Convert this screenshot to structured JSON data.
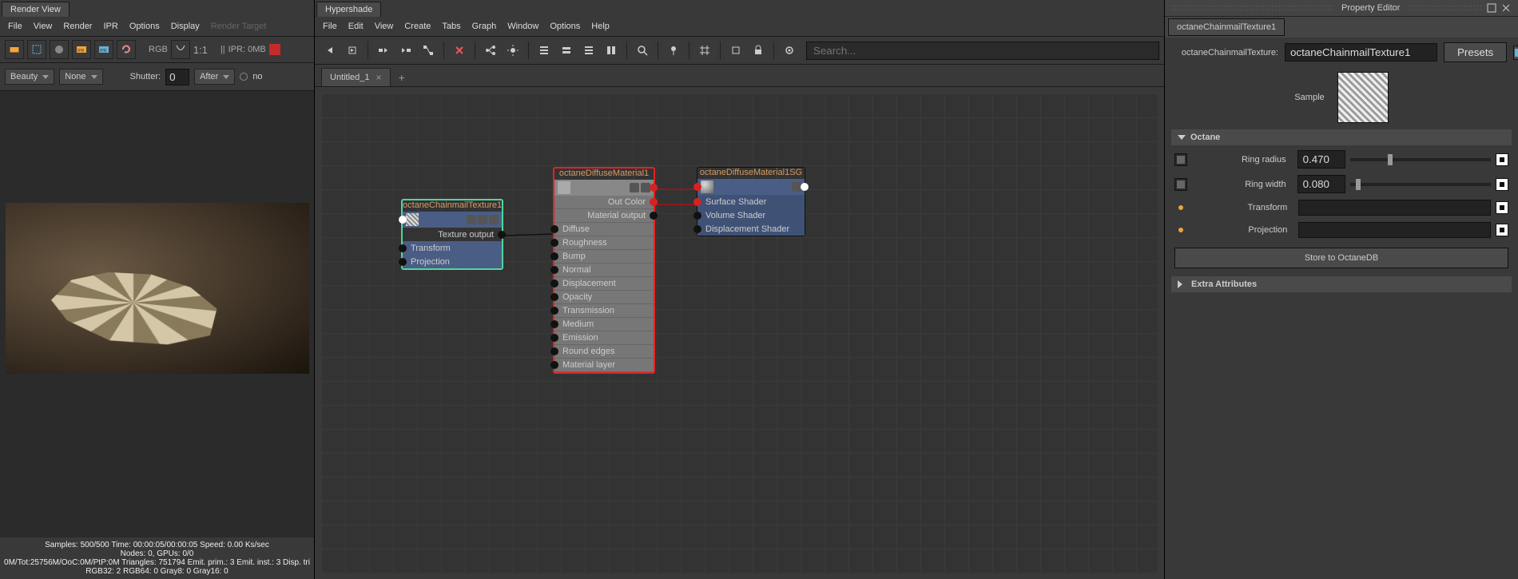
{
  "renderView": {
    "title": "Render View",
    "menu": [
      "File",
      "View",
      "Render",
      "IPR",
      "Options",
      "Display"
    ],
    "menuDisabled": "Render Target",
    "rgbLabel": "RGB",
    "ratioLabel": "1:1",
    "iprLabel": "IPR: 0MB",
    "pause": "||",
    "beauty": "Beauty",
    "none": "None",
    "shutter": "Shutter:",
    "shutterVal": "0",
    "after": "After",
    "no": "no",
    "stats": {
      "line1": "Samples: 500/500 Time: 00:00:05/00:00:05 Speed: 0.00 Ks/sec",
      "line2": "Nodes: 0, GPUs: 0/0",
      "line3": "0M/Tot:25756M/OoC:0M/PtP:0M Triangles: 751794 Emit. prim.: 3 Emit. inst.: 3 Disp. tri",
      "line4": "RGB32: 2 RGB64: 0 Gray8: 0 Gray16: 0"
    }
  },
  "hypershade": {
    "title": "Hypershade",
    "menu": [
      "File",
      "Edit",
      "View",
      "Create",
      "Tabs",
      "Graph",
      "Window",
      "Options",
      "Help"
    ],
    "searchPlaceholder": "Search...",
    "docTab": "Untitled_1",
    "nodes": {
      "chainmail": {
        "title": "octaneChainmailTexture1",
        "out": "Texture output",
        "rows": [
          "Transform",
          "Projection"
        ]
      },
      "diffuse": {
        "title": "octaneDiffuseMaterial1",
        "out1": "Out Color",
        "out2": "Material output",
        "rows": [
          "Diffuse",
          "Roughness",
          "Bump",
          "Normal",
          "Displacement",
          "Opacity",
          "Transmission",
          "Medium",
          "Emission",
          "Round edges",
          "Material layer"
        ]
      },
      "sg": {
        "title": "octaneDiffuseMaterial1SG",
        "rows": [
          "Surface Shader",
          "Volume Shader",
          "Displacement Shader"
        ]
      }
    }
  },
  "propertyEditor": {
    "title": "Property Editor",
    "tab": "octaneChainmailTexture1",
    "typeLabel": "octaneChainmailTexture:",
    "nameValue": "octaneChainmailTexture1",
    "presets": "Presets",
    "sampleLabel": "Sample",
    "sections": {
      "octane": "Octane",
      "extra": "Extra Attributes"
    },
    "params": {
      "ringRadius": {
        "label": "Ring radius",
        "value": "0.470"
      },
      "ringWidth": {
        "label": "Ring width",
        "value": "0.080"
      },
      "transform": {
        "label": "Transform"
      },
      "projection": {
        "label": "Projection"
      }
    },
    "storeBtn": "Store to OctaneDB"
  }
}
